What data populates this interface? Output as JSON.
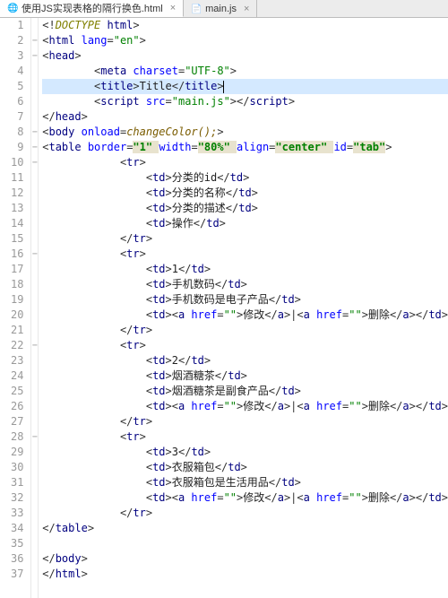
{
  "tabs": {
    "items": [
      {
        "label": "使用JS实现表格的隔行换色.html",
        "active": true,
        "icon": "html"
      },
      {
        "label": "main.js",
        "active": false,
        "icon": "js"
      }
    ]
  },
  "cursor_line": 5,
  "gutter": {
    "start": 1,
    "end": 37
  },
  "fold_marks": {
    "2": "−",
    "3": "−",
    "8": "−",
    "9": "−",
    "10": "−",
    "16": "−",
    "22": "−",
    "28": "−"
  },
  "code": {
    "1": {
      "indent": 0,
      "tokens": [
        [
          "pun",
          "<!"
        ],
        [
          "doctype",
          "DOCTYPE "
        ],
        [
          "tag",
          "html"
        ],
        [
          "pun",
          ">"
        ]
      ]
    },
    "2": {
      "indent": 0,
      "tokens": [
        [
          "pun",
          "<"
        ],
        [
          "tag",
          "html "
        ],
        [
          "attr",
          "lang"
        ],
        [
          "pun",
          "="
        ],
        [
          "val",
          "\"en\""
        ],
        [
          "pun",
          ">"
        ]
      ]
    },
    "3": {
      "indent": 0,
      "tokens": [
        [
          "pun",
          "<"
        ],
        [
          "tag",
          "head"
        ],
        [
          "pun",
          ">"
        ]
      ]
    },
    "4": {
      "indent": 2,
      "tokens": [
        [
          "pun",
          "<"
        ],
        [
          "tag",
          "meta "
        ],
        [
          "attr",
          "charset"
        ],
        [
          "pun",
          "="
        ],
        [
          "val",
          "\"UTF-8\""
        ],
        [
          "pun",
          ">"
        ]
      ]
    },
    "5": {
      "indent": 2,
      "tokens": [
        [
          "pun",
          "<"
        ],
        [
          "tag",
          "title"
        ],
        [
          "pun",
          ">"
        ],
        [
          "txt",
          "Title"
        ],
        [
          "pun",
          "</"
        ],
        [
          "tag",
          "title"
        ],
        [
          "pun",
          ">"
        ]
      ],
      "highlight": true,
      "caret_after": true
    },
    "6": {
      "indent": 2,
      "tokens": [
        [
          "pun",
          "<"
        ],
        [
          "tag",
          "script "
        ],
        [
          "attr",
          "src"
        ],
        [
          "pun",
          "="
        ],
        [
          "val",
          "\"main.js\""
        ],
        [
          "pun",
          ">"
        ],
        [
          "pun",
          "</"
        ],
        [
          "tag",
          "script"
        ],
        [
          "pun",
          ">"
        ]
      ]
    },
    "7": {
      "indent": 0,
      "tokens": [
        [
          "pun",
          "</"
        ],
        [
          "tag",
          "head"
        ],
        [
          "pun",
          ">"
        ]
      ]
    },
    "8": {
      "indent": 0,
      "tokens": [
        [
          "pun",
          "<"
        ],
        [
          "tag",
          "body "
        ],
        [
          "attr",
          "onload"
        ],
        [
          "pun",
          "="
        ],
        [
          "jsf",
          "changeColor();"
        ],
        [
          "pun",
          ">"
        ]
      ]
    },
    "9": {
      "indent": 0,
      "tokens": [
        [
          "pun",
          "<"
        ],
        [
          "tag",
          "table "
        ],
        [
          "attr",
          "border"
        ],
        [
          "pun",
          "="
        ],
        [
          "valb",
          "\"1\" "
        ],
        [
          "attr",
          "width"
        ],
        [
          "pun",
          "="
        ],
        [
          "valb",
          "\"80%\" "
        ],
        [
          "attr",
          "align"
        ],
        [
          "pun",
          "="
        ],
        [
          "valb",
          "\"center\" "
        ],
        [
          "attr",
          "id"
        ],
        [
          "pun",
          "="
        ],
        [
          "valb",
          "\"tab\""
        ],
        [
          "pun",
          ">"
        ]
      ]
    },
    "10": {
      "indent": 3,
      "tokens": [
        [
          "pun",
          "<"
        ],
        [
          "tag",
          "tr"
        ],
        [
          "pun",
          ">"
        ]
      ]
    },
    "11": {
      "indent": 4,
      "tokens": [
        [
          "pun",
          "<"
        ],
        [
          "tag",
          "td"
        ],
        [
          "pun",
          ">"
        ],
        [
          "txt",
          "分类的id"
        ],
        [
          "pun",
          "</"
        ],
        [
          "tag",
          "td"
        ],
        [
          "pun",
          ">"
        ]
      ]
    },
    "12": {
      "indent": 4,
      "tokens": [
        [
          "pun",
          "<"
        ],
        [
          "tag",
          "td"
        ],
        [
          "pun",
          ">"
        ],
        [
          "txt",
          "分类的名称"
        ],
        [
          "pun",
          "</"
        ],
        [
          "tag",
          "td"
        ],
        [
          "pun",
          ">"
        ]
      ]
    },
    "13": {
      "indent": 4,
      "tokens": [
        [
          "pun",
          "<"
        ],
        [
          "tag",
          "td"
        ],
        [
          "pun",
          ">"
        ],
        [
          "txt",
          "分类的描述"
        ],
        [
          "pun",
          "</"
        ],
        [
          "tag",
          "td"
        ],
        [
          "pun",
          ">"
        ]
      ]
    },
    "14": {
      "indent": 4,
      "tokens": [
        [
          "pun",
          "<"
        ],
        [
          "tag",
          "td"
        ],
        [
          "pun",
          ">"
        ],
        [
          "txt",
          "操作"
        ],
        [
          "pun",
          "</"
        ],
        [
          "tag",
          "td"
        ],
        [
          "pun",
          ">"
        ]
      ]
    },
    "15": {
      "indent": 3,
      "tokens": [
        [
          "pun",
          "</"
        ],
        [
          "tag",
          "tr"
        ],
        [
          "pun",
          ">"
        ]
      ]
    },
    "16": {
      "indent": 3,
      "tokens": [
        [
          "pun",
          "<"
        ],
        [
          "tag",
          "tr"
        ],
        [
          "pun",
          ">"
        ]
      ]
    },
    "17": {
      "indent": 4,
      "tokens": [
        [
          "pun",
          "<"
        ],
        [
          "tag",
          "td"
        ],
        [
          "pun",
          ">"
        ],
        [
          "txt",
          "1"
        ],
        [
          "pun",
          "</"
        ],
        [
          "tag",
          "td"
        ],
        [
          "pun",
          ">"
        ]
      ]
    },
    "18": {
      "indent": 4,
      "tokens": [
        [
          "pun",
          "<"
        ],
        [
          "tag",
          "td"
        ],
        [
          "pun",
          ">"
        ],
        [
          "txt",
          "手机数码"
        ],
        [
          "pun",
          "</"
        ],
        [
          "tag",
          "td"
        ],
        [
          "pun",
          ">"
        ]
      ]
    },
    "19": {
      "indent": 4,
      "tokens": [
        [
          "pun",
          "<"
        ],
        [
          "tag",
          "td"
        ],
        [
          "pun",
          ">"
        ],
        [
          "txt",
          "手机数码是电子产品"
        ],
        [
          "pun",
          "</"
        ],
        [
          "tag",
          "td"
        ],
        [
          "pun",
          ">"
        ]
      ]
    },
    "20": {
      "indent": 4,
      "tokens": [
        [
          "pun",
          "<"
        ],
        [
          "tag",
          "td"
        ],
        [
          "pun",
          "><"
        ],
        [
          "tag",
          "a "
        ],
        [
          "attr",
          "href"
        ],
        [
          "pun",
          "="
        ],
        [
          "val",
          "\"\""
        ],
        [
          "pun",
          ">"
        ],
        [
          "txt",
          "修改"
        ],
        [
          "pun",
          "</"
        ],
        [
          "tag",
          "a"
        ],
        [
          "pun",
          ">|<"
        ],
        [
          "tag",
          "a "
        ],
        [
          "attr",
          "href"
        ],
        [
          "pun",
          "="
        ],
        [
          "val",
          "\"\""
        ],
        [
          "pun",
          ">"
        ],
        [
          "txt",
          "删除"
        ],
        [
          "pun",
          "</"
        ],
        [
          "tag",
          "a"
        ],
        [
          "pun",
          "></"
        ],
        [
          "tag",
          "td"
        ],
        [
          "pun",
          ">"
        ]
      ]
    },
    "21": {
      "indent": 3,
      "tokens": [
        [
          "pun",
          "</"
        ],
        [
          "tag",
          "tr"
        ],
        [
          "pun",
          ">"
        ]
      ]
    },
    "22": {
      "indent": 3,
      "tokens": [
        [
          "pun",
          "<"
        ],
        [
          "tag",
          "tr"
        ],
        [
          "pun",
          ">"
        ]
      ]
    },
    "23": {
      "indent": 4,
      "tokens": [
        [
          "pun",
          "<"
        ],
        [
          "tag",
          "td"
        ],
        [
          "pun",
          ">"
        ],
        [
          "txt",
          "2"
        ],
        [
          "pun",
          "</"
        ],
        [
          "tag",
          "td"
        ],
        [
          "pun",
          ">"
        ]
      ]
    },
    "24": {
      "indent": 4,
      "tokens": [
        [
          "pun",
          "<"
        ],
        [
          "tag",
          "td"
        ],
        [
          "pun",
          ">"
        ],
        [
          "txt",
          "烟酒糖茶"
        ],
        [
          "pun",
          "</"
        ],
        [
          "tag",
          "td"
        ],
        [
          "pun",
          ">"
        ]
      ]
    },
    "25": {
      "indent": 4,
      "tokens": [
        [
          "pun",
          "<"
        ],
        [
          "tag",
          "td"
        ],
        [
          "pun",
          ">"
        ],
        [
          "txt",
          "烟酒糖茶是副食产品"
        ],
        [
          "pun",
          "</"
        ],
        [
          "tag",
          "td"
        ],
        [
          "pun",
          ">"
        ]
      ]
    },
    "26": {
      "indent": 4,
      "tokens": [
        [
          "pun",
          "<"
        ],
        [
          "tag",
          "td"
        ],
        [
          "pun",
          "><"
        ],
        [
          "tag",
          "a "
        ],
        [
          "attr",
          "href"
        ],
        [
          "pun",
          "="
        ],
        [
          "val",
          "\"\""
        ],
        [
          "pun",
          ">"
        ],
        [
          "txt",
          "修改"
        ],
        [
          "pun",
          "</"
        ],
        [
          "tag",
          "a"
        ],
        [
          "pun",
          ">|<"
        ],
        [
          "tag",
          "a "
        ],
        [
          "attr",
          "href"
        ],
        [
          "pun",
          "="
        ],
        [
          "val",
          "\"\""
        ],
        [
          "pun",
          ">"
        ],
        [
          "txt",
          "删除"
        ],
        [
          "pun",
          "</"
        ],
        [
          "tag",
          "a"
        ],
        [
          "pun",
          "></"
        ],
        [
          "tag",
          "td"
        ],
        [
          "pun",
          ">"
        ]
      ]
    },
    "27": {
      "indent": 3,
      "tokens": [
        [
          "pun",
          "</"
        ],
        [
          "tag",
          "tr"
        ],
        [
          "pun",
          ">"
        ]
      ]
    },
    "28": {
      "indent": 3,
      "tokens": [
        [
          "pun",
          "<"
        ],
        [
          "tag",
          "tr"
        ],
        [
          "pun",
          ">"
        ]
      ]
    },
    "29": {
      "indent": 4,
      "tokens": [
        [
          "pun",
          "<"
        ],
        [
          "tag",
          "td"
        ],
        [
          "pun",
          ">"
        ],
        [
          "txt",
          "3"
        ],
        [
          "pun",
          "</"
        ],
        [
          "tag",
          "td"
        ],
        [
          "pun",
          ">"
        ]
      ]
    },
    "30": {
      "indent": 4,
      "tokens": [
        [
          "pun",
          "<"
        ],
        [
          "tag",
          "td"
        ],
        [
          "pun",
          ">"
        ],
        [
          "txt",
          "衣服箱包"
        ],
        [
          "pun",
          "</"
        ],
        [
          "tag",
          "td"
        ],
        [
          "pun",
          ">"
        ]
      ]
    },
    "31": {
      "indent": 4,
      "tokens": [
        [
          "pun",
          "<"
        ],
        [
          "tag",
          "td"
        ],
        [
          "pun",
          ">"
        ],
        [
          "txt",
          "衣服箱包是生活用品"
        ],
        [
          "pun",
          "</"
        ],
        [
          "tag",
          "td"
        ],
        [
          "pun",
          ">"
        ]
      ]
    },
    "32": {
      "indent": 4,
      "tokens": [
        [
          "pun",
          "<"
        ],
        [
          "tag",
          "td"
        ],
        [
          "pun",
          "><"
        ],
        [
          "tag",
          "a "
        ],
        [
          "attr",
          "href"
        ],
        [
          "pun",
          "="
        ],
        [
          "val",
          "\"\""
        ],
        [
          "pun",
          ">"
        ],
        [
          "txt",
          "修改"
        ],
        [
          "pun",
          "</"
        ],
        [
          "tag",
          "a"
        ],
        [
          "pun",
          ">|<"
        ],
        [
          "tag",
          "a "
        ],
        [
          "attr",
          "href"
        ],
        [
          "pun",
          "="
        ],
        [
          "val",
          "\"\""
        ],
        [
          "pun",
          ">"
        ],
        [
          "txt",
          "删除"
        ],
        [
          "pun",
          "</"
        ],
        [
          "tag",
          "a"
        ],
        [
          "pun",
          "></"
        ],
        [
          "tag",
          "td"
        ],
        [
          "pun",
          ">"
        ]
      ]
    },
    "33": {
      "indent": 3,
      "tokens": [
        [
          "pun",
          "</"
        ],
        [
          "tag",
          "tr"
        ],
        [
          "pun",
          ">"
        ]
      ]
    },
    "34": {
      "indent": 0,
      "tokens": [
        [
          "pun",
          "</"
        ],
        [
          "tag",
          "table"
        ],
        [
          "pun",
          ">"
        ]
      ]
    },
    "35": {
      "indent": 0,
      "tokens": []
    },
    "36": {
      "indent": 0,
      "tokens": [
        [
          "pun",
          "</"
        ],
        [
          "tag",
          "body"
        ],
        [
          "pun",
          ">"
        ]
      ]
    },
    "37": {
      "indent": 0,
      "tokens": [
        [
          "pun",
          "</"
        ],
        [
          "tag",
          "html"
        ],
        [
          "pun",
          ">"
        ]
      ]
    }
  }
}
